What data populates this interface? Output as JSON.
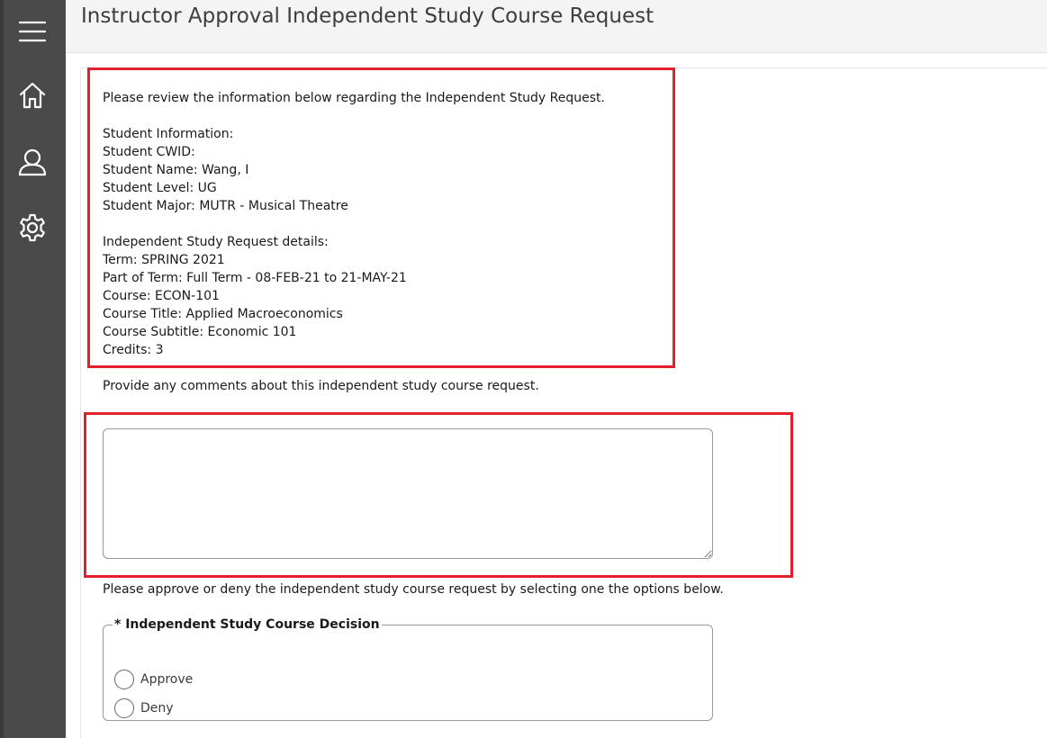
{
  "header": {
    "title": "Instructor Approval Independent Study Course Request"
  },
  "sidebar": {
    "items": [
      {
        "name": "menu",
        "icon": "hamburger-menu-icon"
      },
      {
        "name": "home",
        "icon": "home-icon"
      },
      {
        "name": "profile",
        "icon": "user-icon"
      },
      {
        "name": "settings",
        "icon": "gear-icon"
      }
    ]
  },
  "info": {
    "intro": "Please review the information below regarding the Independent Study Request.",
    "student_heading": "Student Information:",
    "student_cwid": "Student CWID:",
    "student_name": "Student Name: Wang, I",
    "student_level": "Student Level: UG",
    "student_major": "Student Major: MUTR - Musical Theatre",
    "details_heading": "Independent Study Request details:",
    "term": "Term: SPRING 2021",
    "part_of_term": "Part of Term: Full Term - 08-FEB-21 to 21-MAY-21",
    "course": "Course: ECON-101",
    "course_title": "Course Title: Applied Macroeconomics",
    "course_subtitle": "Course Subtitle: Economic 101",
    "credits": "Credits: 3"
  },
  "comments": {
    "prompt": "Provide any comments about this independent study course request.",
    "value": ""
  },
  "decision": {
    "prompt": "Please approve or deny the independent study course request by selecting one the options below.",
    "legend": "* Independent Study Course Decision",
    "options": [
      {
        "label": "Approve",
        "selected": false
      },
      {
        "label": "Deny",
        "selected": false
      }
    ]
  },
  "colors": {
    "sidebar": "#4a4a4a",
    "highlight": "#e3202b",
    "header_bg": "#f4f4f4"
  }
}
